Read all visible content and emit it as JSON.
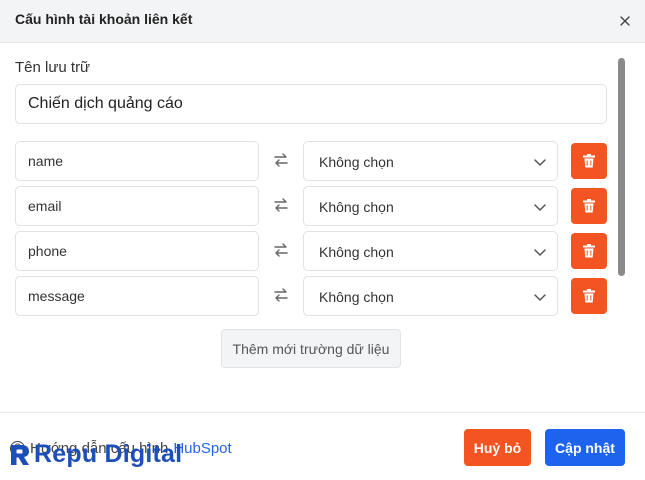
{
  "dialog": {
    "title": "Cấu hình tài khoản liên kết"
  },
  "form": {
    "name_label": "Tên lưu trữ",
    "name_value": "Chiến dịch quảng cáo"
  },
  "mappings": [
    {
      "field": "name",
      "target": "Không chọn"
    },
    {
      "field": "email",
      "target": "Không chọn"
    },
    {
      "field": "phone",
      "target": "Không chọn"
    },
    {
      "field": "message",
      "target": "Không chọn"
    }
  ],
  "add_field_label": "Thêm mới trường dữ liệu",
  "footer": {
    "guide_prefix": "Hướng dẫn cấu hình",
    "guide_link": "HubSpot",
    "logo_text": "Repu Digital",
    "cancel_label": "Huỷ bỏ",
    "update_label": "Cập nhật"
  },
  "colors": {
    "danger": "#f35421",
    "primary": "#1d63ed",
    "logo": "#1d4fb8",
    "link": "#2563eb"
  },
  "icons": {
    "close": "close-icon",
    "swap": "swap-arrows-icon",
    "chevron": "chevron-down-icon",
    "delete": "trash-icon",
    "help": "question-circle-icon",
    "logo": "repu-logo-icon"
  }
}
